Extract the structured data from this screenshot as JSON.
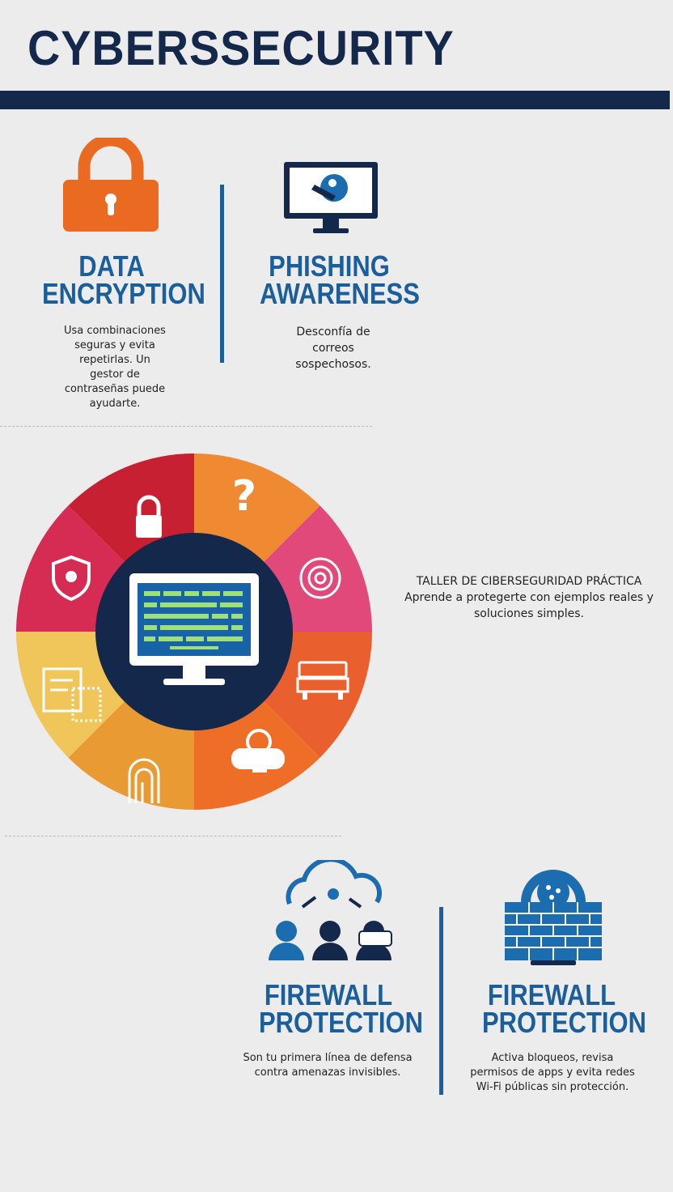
{
  "header": {
    "title": "CYBERSSECURITY"
  },
  "top": {
    "left": {
      "heading_line1": "DATA",
      "heading_line2": "ENCRYPTION",
      "description": "Usa combinaciones seguras y evita repetirlas. Un gestor de contraseñas puede ayudarte.",
      "icon": "padlock-icon"
    },
    "right": {
      "heading_line1": "PHISHING",
      "heading_line2": "AWARENESS",
      "description": "Desconfía de correos sospechosos.",
      "icon": "monitor-phishing-icon"
    }
  },
  "wheel": {
    "center_icon": "computer-code-icon",
    "segments": [
      {
        "icon": "question-icon",
        "color": "#ef8a33"
      },
      {
        "icon": "fingerprint-badge-icon",
        "color": "#e0497a"
      },
      {
        "icon": "server-icon",
        "color": "#e95f2d"
      },
      {
        "icon": "cloud-alarm-icon",
        "color": "#ef6e27"
      },
      {
        "icon": "fingerprint-lock-icon",
        "color": "#e99a33"
      },
      {
        "icon": "document-icon",
        "color": "#f0c65a"
      },
      {
        "icon": "shield-icon",
        "color": "#d62b52"
      },
      {
        "icon": "padlock-icon",
        "color": "#c62032"
      }
    ]
  },
  "workshop": {
    "title": "TALLER DE CIBERSEGURIDAD PRÁCTICA",
    "subtitle": "Aprende a protegerte con ejemplos reales y soluciones simples."
  },
  "bottom": {
    "left": {
      "heading_line1": "FIREWALL",
      "heading_line2": "PROTECTION",
      "description": "Son tu primera línea de defensa contra amenazas invisibles.",
      "icon": "cloud-users-icon"
    },
    "right": {
      "heading_line1": "FIREWALL",
      "heading_line2": "PROTECTION",
      "description": "Activa bloqueos, revisa permisos de apps y evita redes Wi-Fi públicas sin protección.",
      "icon": "firewall-wall-icon"
    }
  }
}
